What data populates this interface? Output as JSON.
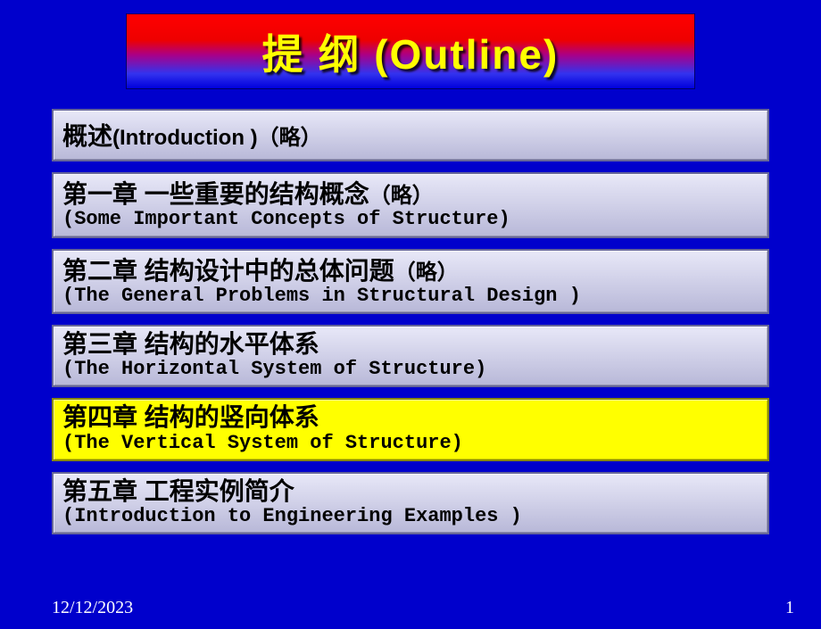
{
  "title": "提  纲  (Outline)",
  "chapters": [
    {
      "main": "概述",
      "main_suffix": "(Introduction )（略）",
      "sub": "",
      "highlighted": false,
      "single": true
    },
    {
      "main": "第一章 一些重要的结构概念",
      "main_suffix": "（略）",
      "sub": "(Some Important Concepts of Structure)",
      "highlighted": false,
      "single": false
    },
    {
      "main": "第二章  结构设计中的总体问题",
      "main_suffix": "（略）",
      "sub": "(The General Problems in Structural Design )",
      "highlighted": false,
      "single": false
    },
    {
      "main": "第三章  结构的水平体系",
      "main_suffix": "",
      "sub": "(The Horizontal System of Structure)",
      "highlighted": false,
      "single": false
    },
    {
      "main": "第四章  结构的竖向体系",
      "main_suffix": "",
      "sub": "(The Vertical System of Structure)",
      "highlighted": true,
      "single": false
    },
    {
      "main": "第五章  工程实例简介",
      "main_suffix": "",
      "sub": "(Introduction to Engineering Examples )",
      "highlighted": false,
      "single": false
    }
  ],
  "footer": {
    "date": "12/12/2023",
    "page": "1"
  }
}
